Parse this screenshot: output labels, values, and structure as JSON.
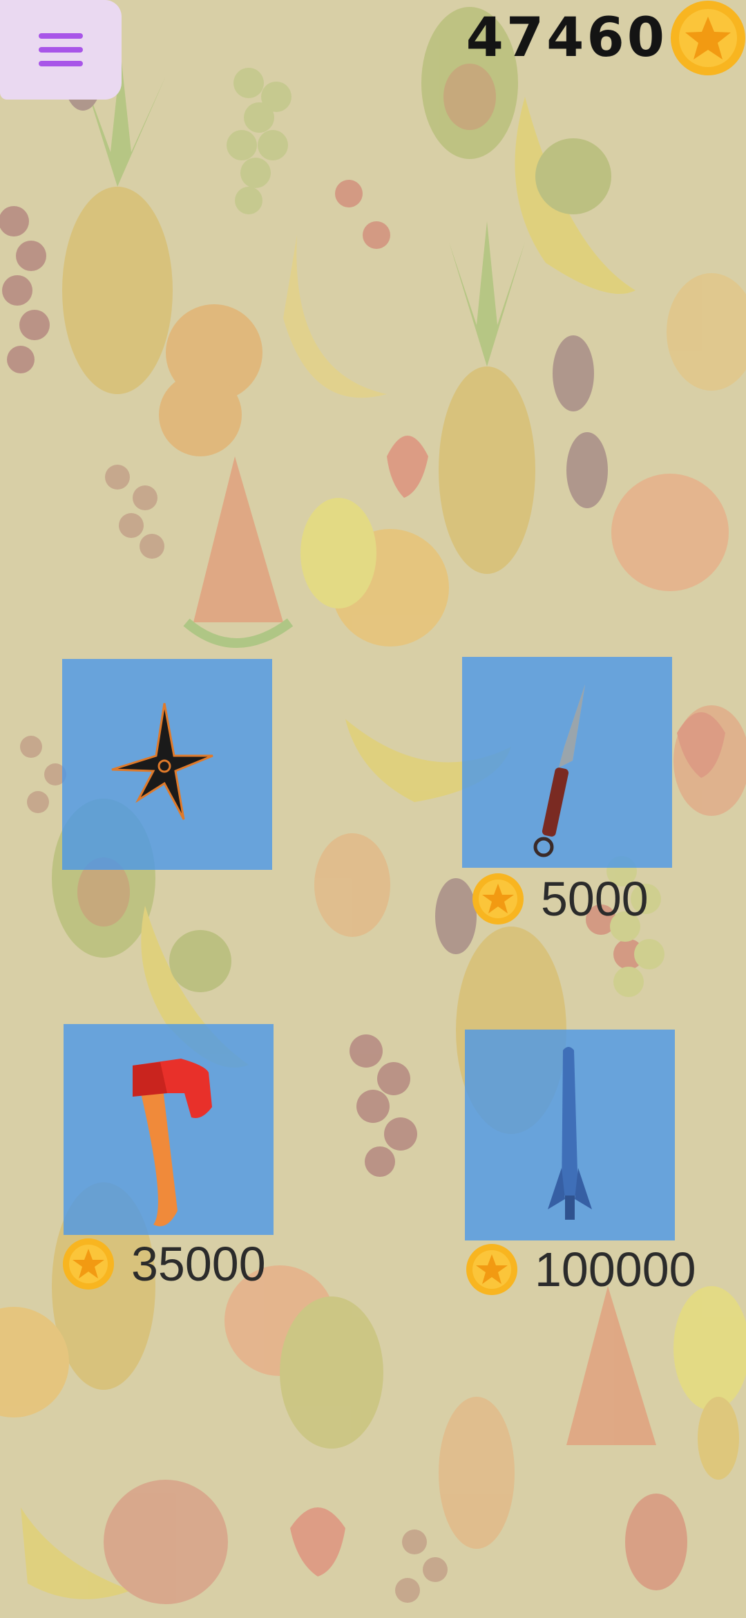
{
  "header": {
    "menu_icon": "hamburger-menu-icon",
    "coin_balance": "47460",
    "coin_icon": "star-coin-icon"
  },
  "shop": {
    "items": [
      {
        "name": "shuriken",
        "icon": "shuriken-icon",
        "price": ""
      },
      {
        "name": "kunai",
        "icon": "kunai-icon",
        "price": "5000"
      },
      {
        "name": "axe",
        "icon": "axe-icon",
        "price": "35000"
      },
      {
        "name": "rocket",
        "icon": "rocket-icon",
        "price": "100000"
      }
    ]
  },
  "colors": {
    "background": "#d8cfa6",
    "card": "#4896eb",
    "menu_button": "#ead9f1",
    "menu_icon": "#a855e8",
    "coin": "#f8b520"
  }
}
